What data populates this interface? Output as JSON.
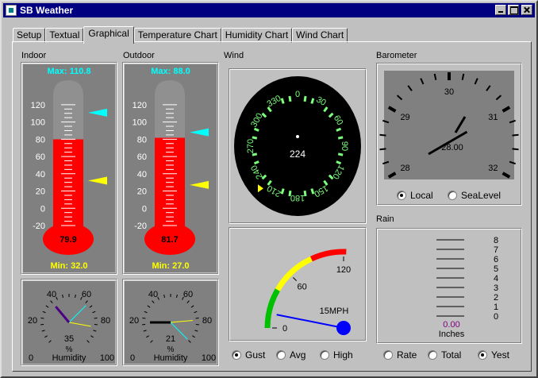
{
  "window": {
    "title": "SB Weather"
  },
  "tabs": [
    "Setup",
    "Textual",
    "Graphical",
    "Temperature Chart",
    "Humidity Chart",
    "Wind Chart"
  ],
  "active_tab": "Graphical",
  "indoor": {
    "label": "Indoor",
    "max_label": "Max:",
    "max_value": "110.8",
    "min_label": "Min:",
    "min_value": "32.0",
    "current": "79.9",
    "scale_ticks": [
      "120",
      "100",
      "80",
      "60",
      "40",
      "20",
      "0",
      "-20"
    ],
    "max_marker": 110.8,
    "min_marker": 32.0,
    "fill_value": 79.9
  },
  "outdoor": {
    "label": "Outdoor",
    "max_label": "Max:",
    "max_value": "88.0",
    "min_label": "Min:",
    "min_value": "27.0",
    "current": "81.7",
    "scale_ticks": [
      "120",
      "100",
      "80",
      "60",
      "40",
      "20",
      "0",
      "-20"
    ],
    "max_marker": 88.0,
    "min_marker": 27.0,
    "fill_value": 81.7
  },
  "indoor_humidity": {
    "ticks": [
      "0",
      "20",
      "40",
      "60",
      "80",
      "100"
    ],
    "value": "35",
    "unit": "%",
    "caption": "Humidity"
  },
  "outdoor_humidity": {
    "ticks": [
      "0",
      "20",
      "40",
      "60",
      "80",
      "100"
    ],
    "value": "21",
    "unit": "%",
    "caption": "Humidity"
  },
  "wind": {
    "label": "Wind",
    "direction": "224",
    "compass_labels": [
      "0",
      "30",
      "60",
      "90",
      "120",
      "150",
      "180",
      "210",
      "240",
      "270",
      "300",
      "330"
    ],
    "speed_scale": [
      "0",
      "60",
      "120"
    ],
    "speed_readout": "15MPH",
    "speed_value": 15,
    "options": [
      "Gust",
      "Avg",
      "High"
    ],
    "selected": "Gust"
  },
  "barometer": {
    "label": "Barometer",
    "value": "28.00",
    "ticks": [
      "28",
      "29",
      "30",
      "31",
      "32"
    ],
    "options": [
      "Local",
      "SeaLevel"
    ],
    "selected": "Local"
  },
  "rain": {
    "label": "Rain",
    "scale": [
      "8",
      "7",
      "6",
      "5",
      "4",
      "3",
      "2",
      "1",
      "0"
    ],
    "value": "0.00",
    "unit": "Inches",
    "options": [
      "Rate",
      "Total",
      "Yest"
    ],
    "selected": "Yest"
  },
  "colors": {
    "titlebar": "#000080",
    "mercury": "#ff0000",
    "max_marker": "#00ffff",
    "min_marker": "#ffff00",
    "compass_text": "#7cff7c",
    "wind_needle": "#0000ff",
    "rain_value": "#800080"
  },
  "icons": [
    "app-icon",
    "minimize-icon",
    "maximize-icon",
    "close-icon"
  ]
}
